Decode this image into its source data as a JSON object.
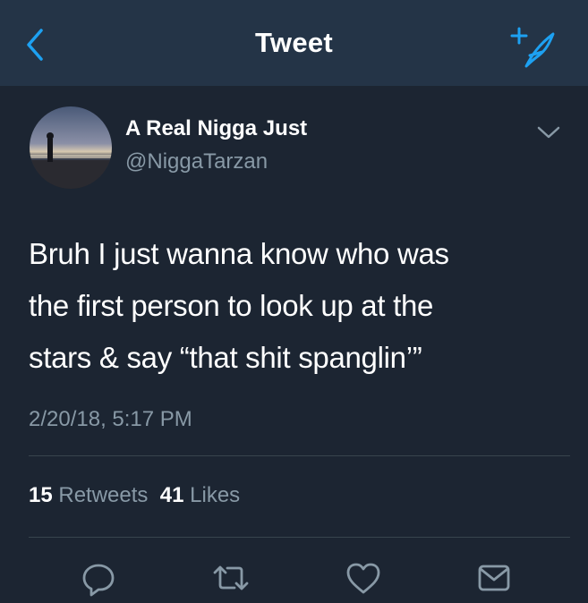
{
  "header": {
    "title": "Tweet",
    "back_icon": "chevron-left-icon",
    "compose_icon": "compose-quill-icon"
  },
  "author": {
    "name": "A Real Nigga Just",
    "handle": "@NiggaTarzan",
    "avatar": "profile-photo"
  },
  "tweet": {
    "lines": [
      "Bruh I just wanna know who was",
      "the first person to look up at the",
      "stars & say “that shit spanglin’”"
    ],
    "timestamp": "2/20/18, 5:17 PM"
  },
  "stats": {
    "retweets_count": "15",
    "retweets_label": "Retweets",
    "likes_count": "41",
    "likes_label": "Likes"
  },
  "actions": [
    "reply-icon",
    "retweet-icon",
    "like-icon",
    "share-icon"
  ],
  "colors": {
    "background": "#1c2532",
    "header": "#243447",
    "accent": "#1da1f2",
    "secondary_text": "#8899a6",
    "divider": "#38444d"
  }
}
